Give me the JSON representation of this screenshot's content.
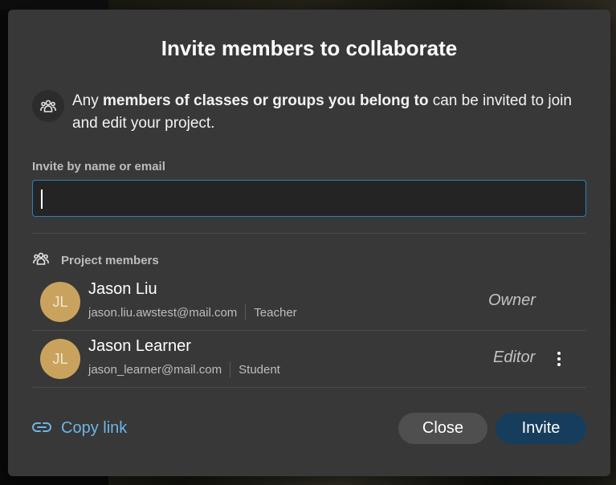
{
  "dialog": {
    "title": "Invite members to collaborate",
    "info": {
      "prefix": "Any ",
      "bold": "members of classes or groups you belong to",
      "suffix": " can be invited to join and edit your project."
    },
    "field_label": "Invite by name or email",
    "input_value": "",
    "members_header": "Project members",
    "members": [
      {
        "initials": "JL",
        "name": "Jason Liu",
        "email": "jason.liu.awstest@mail.com",
        "type": "Teacher",
        "role": "Owner"
      },
      {
        "initials": "JL",
        "name": "Jason Learner",
        "email": "jason_learner@mail.com",
        "type": "Student",
        "role": "Editor"
      }
    ],
    "copy_link_label": "Copy link",
    "close_label": "Close",
    "invite_label": "Invite"
  },
  "colors": {
    "dialog_bg": "#383838",
    "avatar": "#c9a35e",
    "link": "#6fb4e6",
    "primary_button": "#163d5c",
    "input_focus_border": "#2e7fb3"
  },
  "icons": {
    "info": "people-group-icon",
    "members": "people-group-icon",
    "copy_link": "link-icon",
    "member_menu": "kebab-menu-icon"
  }
}
